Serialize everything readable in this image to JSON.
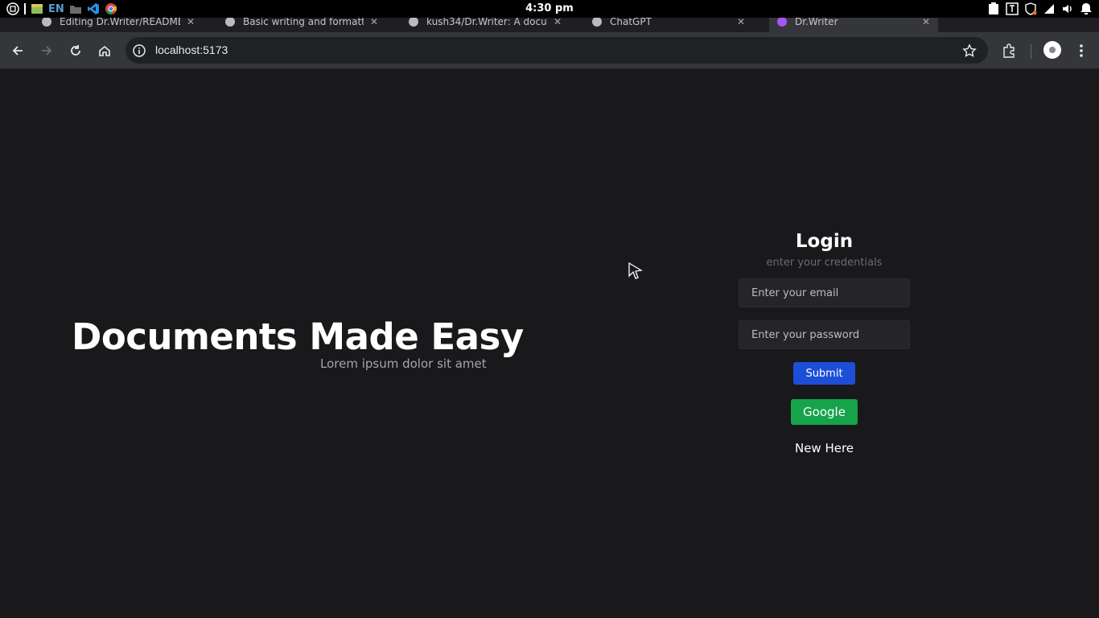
{
  "os": {
    "time": "4:30 pm",
    "lang": "EN"
  },
  "tabs": [
    {
      "title": "Editing Dr.Writer/README"
    },
    {
      "title": "Basic writing and formatti"
    },
    {
      "title": "kush34/Dr.Writer: A docum"
    },
    {
      "title": "ChatGPT"
    },
    {
      "title": "Dr.Writer"
    }
  ],
  "toolbar": {
    "url": "localhost:5173"
  },
  "hero": {
    "title": "Documents Made Easy",
    "subtitle": "Lorem ipsum dolor sit amet"
  },
  "login": {
    "title": "Login",
    "subtitle": "enter your credentials",
    "email_placeholder": "Enter your email",
    "password_placeholder": "Enter your password",
    "submit_label": "Submit",
    "google_label": "Google",
    "new_here": "New Here"
  },
  "colors": {
    "background": "#19191c",
    "submit": "#1d4ed8",
    "google": "#16a34a"
  }
}
